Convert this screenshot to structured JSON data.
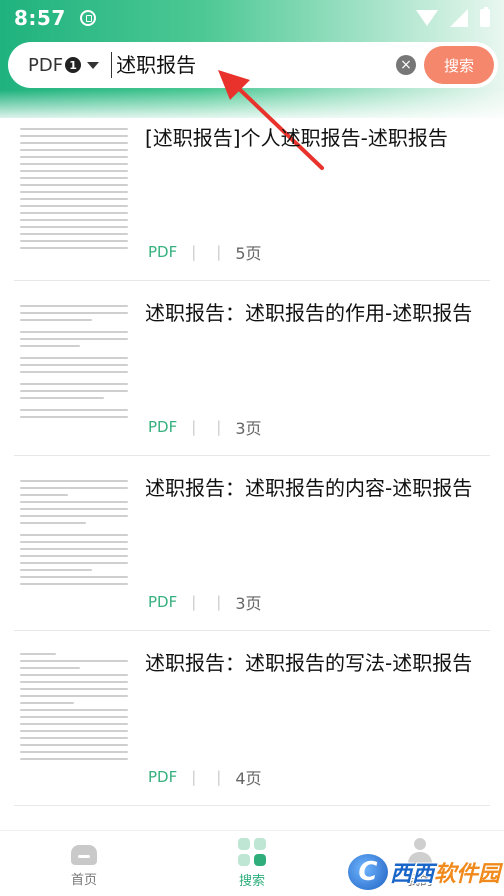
{
  "status_bar": {
    "time": "8:57"
  },
  "search": {
    "type_label": "PDF",
    "type_badge": "1",
    "query": "述职报告",
    "submit_label": "搜索"
  },
  "results": [
    {
      "title": "[述职报告]个人述职报告-述职报告",
      "format": "PDF",
      "pages": "5页"
    },
    {
      "title": "述职报告：述职报告的作用-述职报告",
      "format": "PDF",
      "pages": "3页"
    },
    {
      "title": "述职报告：述职报告的内容-述职报告",
      "format": "PDF",
      "pages": "3页"
    },
    {
      "title": "述职报告：述职报告的写法-述职报告",
      "format": "PDF",
      "pages": "4页"
    }
  ],
  "nav": {
    "tabs": [
      {
        "label": "首页",
        "icon": "home-icon"
      },
      {
        "label": "搜索",
        "icon": "grid-icon"
      },
      {
        "label": "我的",
        "icon": "user-icon"
      }
    ],
    "active": 1
  },
  "watermark": {
    "text_a": "西西",
    "text_b": "软件园"
  },
  "colors": {
    "accent": "#2fae7c",
    "search_button": "#f4876c",
    "annotation_arrow": "#e8322b"
  }
}
